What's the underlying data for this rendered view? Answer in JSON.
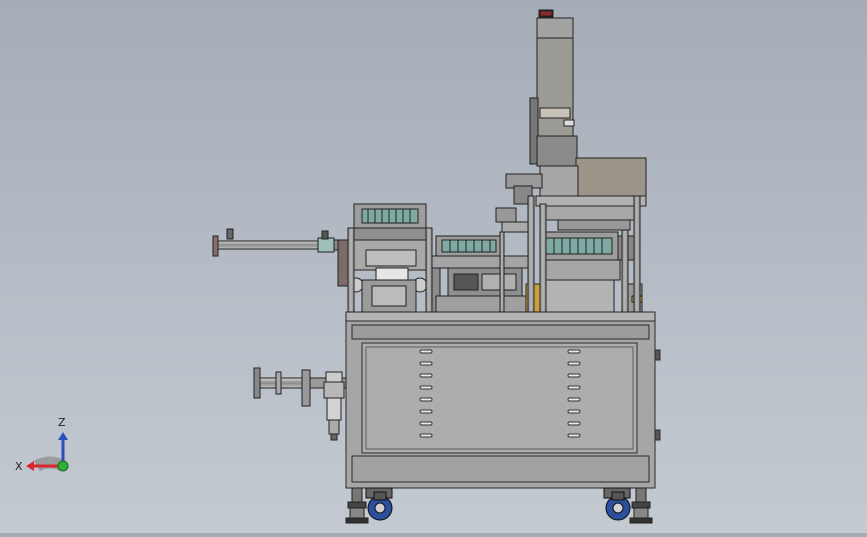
{
  "viewport": {
    "background_top": "#a4acb6",
    "background_bottom": "#c4cad1",
    "model_colors": {
      "frame": "#9a9a9a",
      "cabinet": "#a8a8a8",
      "housing": "#9c9a94",
      "outline": "#2a2a2a",
      "caster": "#2b4f9c",
      "label_accent": "#c8a040",
      "coil": "#7fa9a3"
    }
  },
  "triad": {
    "x_label": "X",
    "z_label": "Z",
    "x_color": "#d9272d",
    "z_color": "#2a4fbf",
    "y_color": "#2fae3a"
  }
}
